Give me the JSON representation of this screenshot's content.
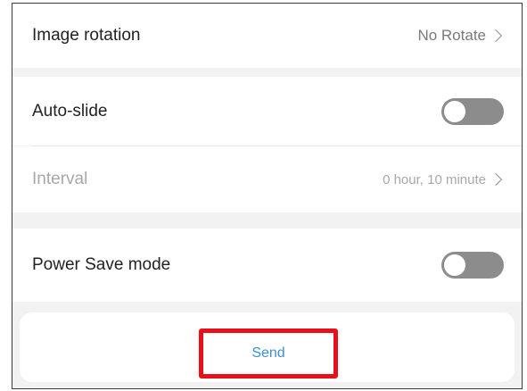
{
  "image_rotation": {
    "label": "Image rotation",
    "value": "No Rotate"
  },
  "auto_slide": {
    "label": "Auto-slide",
    "enabled": false
  },
  "interval": {
    "label": "Interval",
    "value": "0 hour, 10 minute"
  },
  "power_save": {
    "label": "Power Save mode",
    "enabled": false
  },
  "send": {
    "label": "Send",
    "highlight_color": "#e8101a",
    "text_color": "#3a8fd8"
  }
}
